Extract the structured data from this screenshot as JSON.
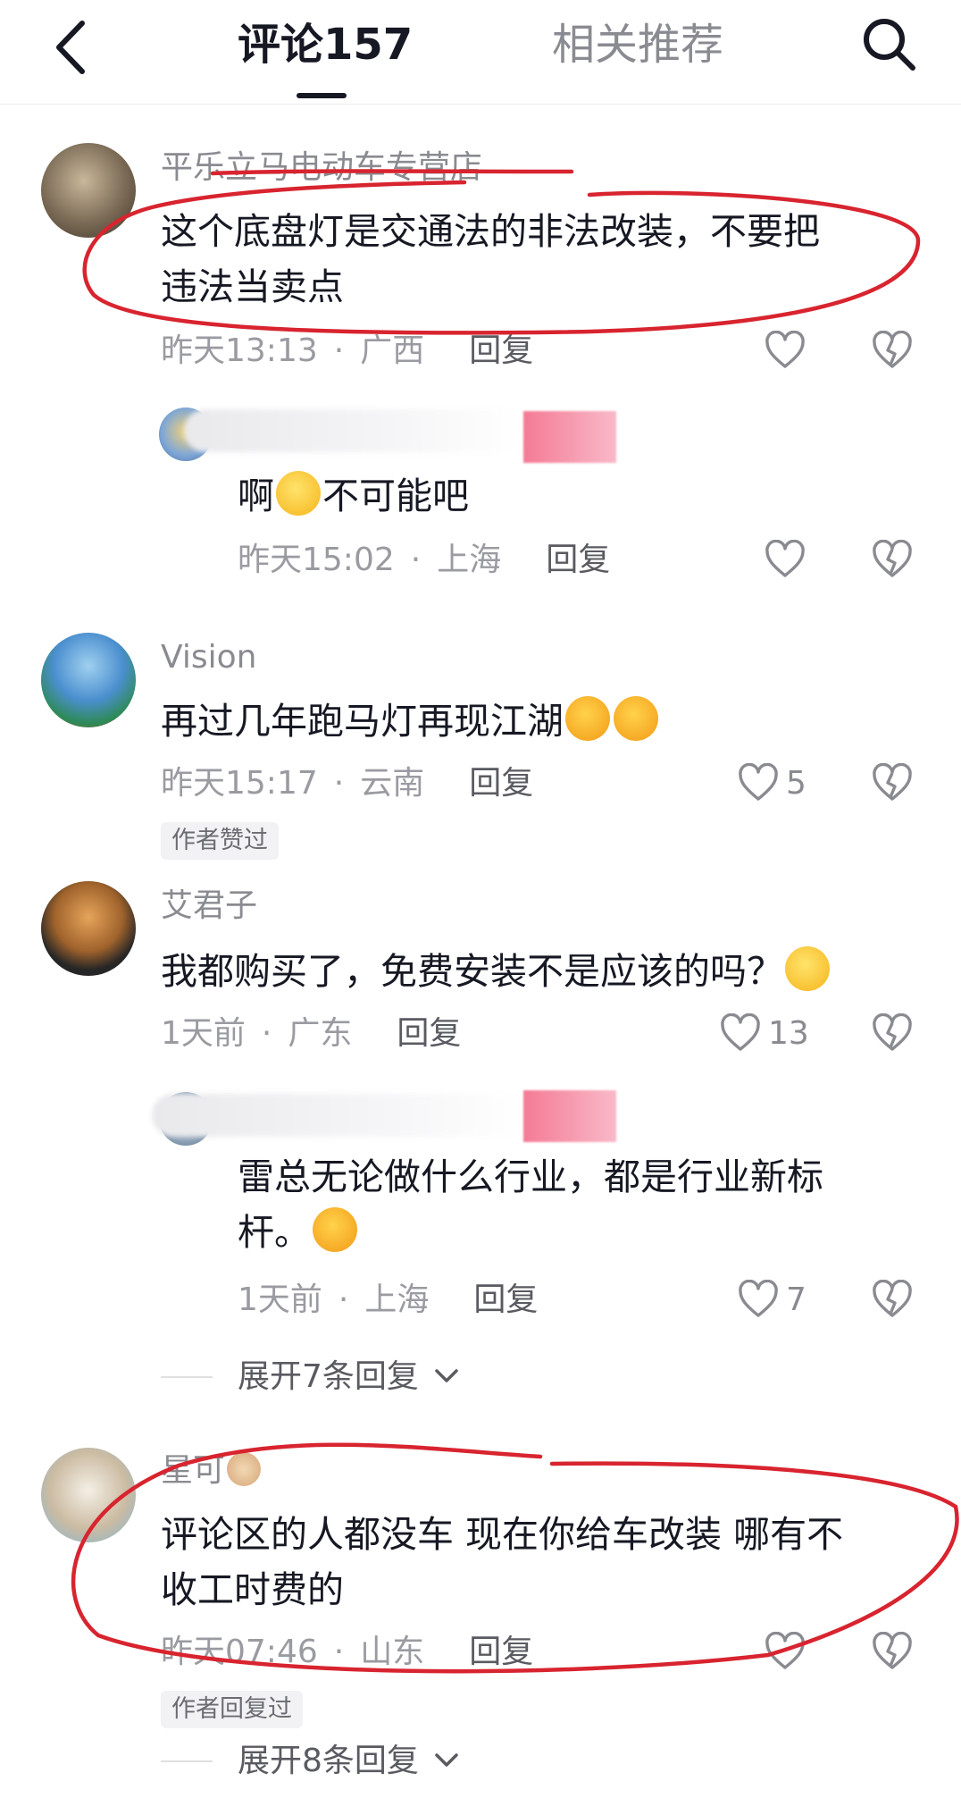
{
  "header": {
    "tab_comments": "评论157",
    "tab_related": "相关推荐"
  },
  "icons": {
    "like": "heart-outline-icon",
    "dislike": "broken-heart-icon",
    "back": "chevron-left-icon",
    "search": "search-icon",
    "expand": "chevron-down-icon"
  },
  "colors": {
    "annotation": "#d8242f",
    "text": "#161823",
    "secondary": "#8a8b91"
  },
  "comments": [
    {
      "username": "平乐立马电动车专营店",
      "text_line1": "这个底盘灯是交通法的非法改装，不要把",
      "text_line2": "违法当卖点",
      "time": "昨天13:13",
      "location": "广西",
      "reply": "回复",
      "sub_reply": {
        "text": "啊",
        "text_after": "不可能吧",
        "time": "昨天15:02",
        "location": "上海",
        "reply": "回复"
      }
    },
    {
      "username": "Vision",
      "text": "再过几年跑马灯再现江湖",
      "time": "昨天15:17",
      "location": "云南",
      "reply": "回复",
      "likes": "5",
      "badge": "作者赞过"
    },
    {
      "username": "艾君子",
      "text": "我都购买了，免费安装不是应该的吗？",
      "time": "1天前",
      "location": "广东",
      "reply": "回复",
      "likes": "13",
      "sub_reply": {
        "text_line1": "雷总无论做什么行业，都是行业新标",
        "text_line2": "杆。",
        "time": "1天前",
        "location": "上海",
        "reply": "回复",
        "likes": "7"
      },
      "expand": "展开7条回复"
    },
    {
      "username": "星可",
      "text_line1": "评论区的人都没车 现在你给车改装 哪有不",
      "text_line2": "收工时费的",
      "time": "昨天07:46",
      "location": "山东",
      "reply": "回复",
      "badge": "作者回复过",
      "expand": "展开8条回复"
    }
  ]
}
